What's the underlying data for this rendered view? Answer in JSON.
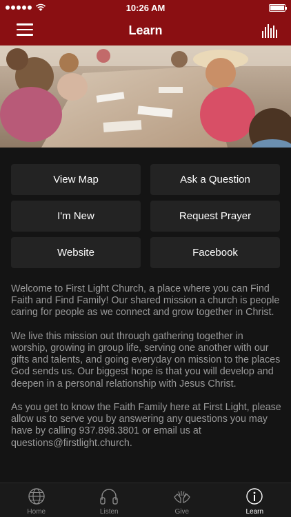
{
  "status_bar": {
    "time": "10:26 AM"
  },
  "nav": {
    "title": "Learn",
    "menu_icon": "hamburger-menu-icon",
    "right_icon": "equalizer-bars-icon"
  },
  "hero": {
    "description": "children-at-table-coloring-photo"
  },
  "buttons": [
    {
      "label": "View Map"
    },
    {
      "label": "Ask a Question"
    },
    {
      "label": "I'm New"
    },
    {
      "label": "Request Prayer"
    },
    {
      "label": "Website"
    },
    {
      "label": "Facebook"
    }
  ],
  "content": {
    "paragraph_1": "Welcome to First Light Church, a place where you can Find Faith and Find Family! Our shared mission a church is people caring for people as we connect and grow together in Christ.",
    "paragraph_2": "We live this mission out through gathering together in worship, growing in group life, serving one another with our gifts and talents, and going everyday on mission to the places God sends us. Our biggest hope is that you will develop and deepen in a personal relationship with Jesus Christ.",
    "paragraph_3": "As you get to know the Faith Family here at First Light, please allow us to serve you by answering any questions you may have by calling 937.898.3801 or email us at questions@firstlight.church."
  },
  "tabs": [
    {
      "label": "Home",
      "icon": "globe-icon"
    },
    {
      "label": "Listen",
      "icon": "headphones-icon"
    },
    {
      "label": "Give",
      "icon": "hands-icon"
    },
    {
      "label": "Learn",
      "icon": "info-icon",
      "active": true
    }
  ],
  "colors": {
    "brand": "#8a0f12",
    "background": "#141414",
    "button": "#232323",
    "text_muted": "#9a9a9a"
  }
}
